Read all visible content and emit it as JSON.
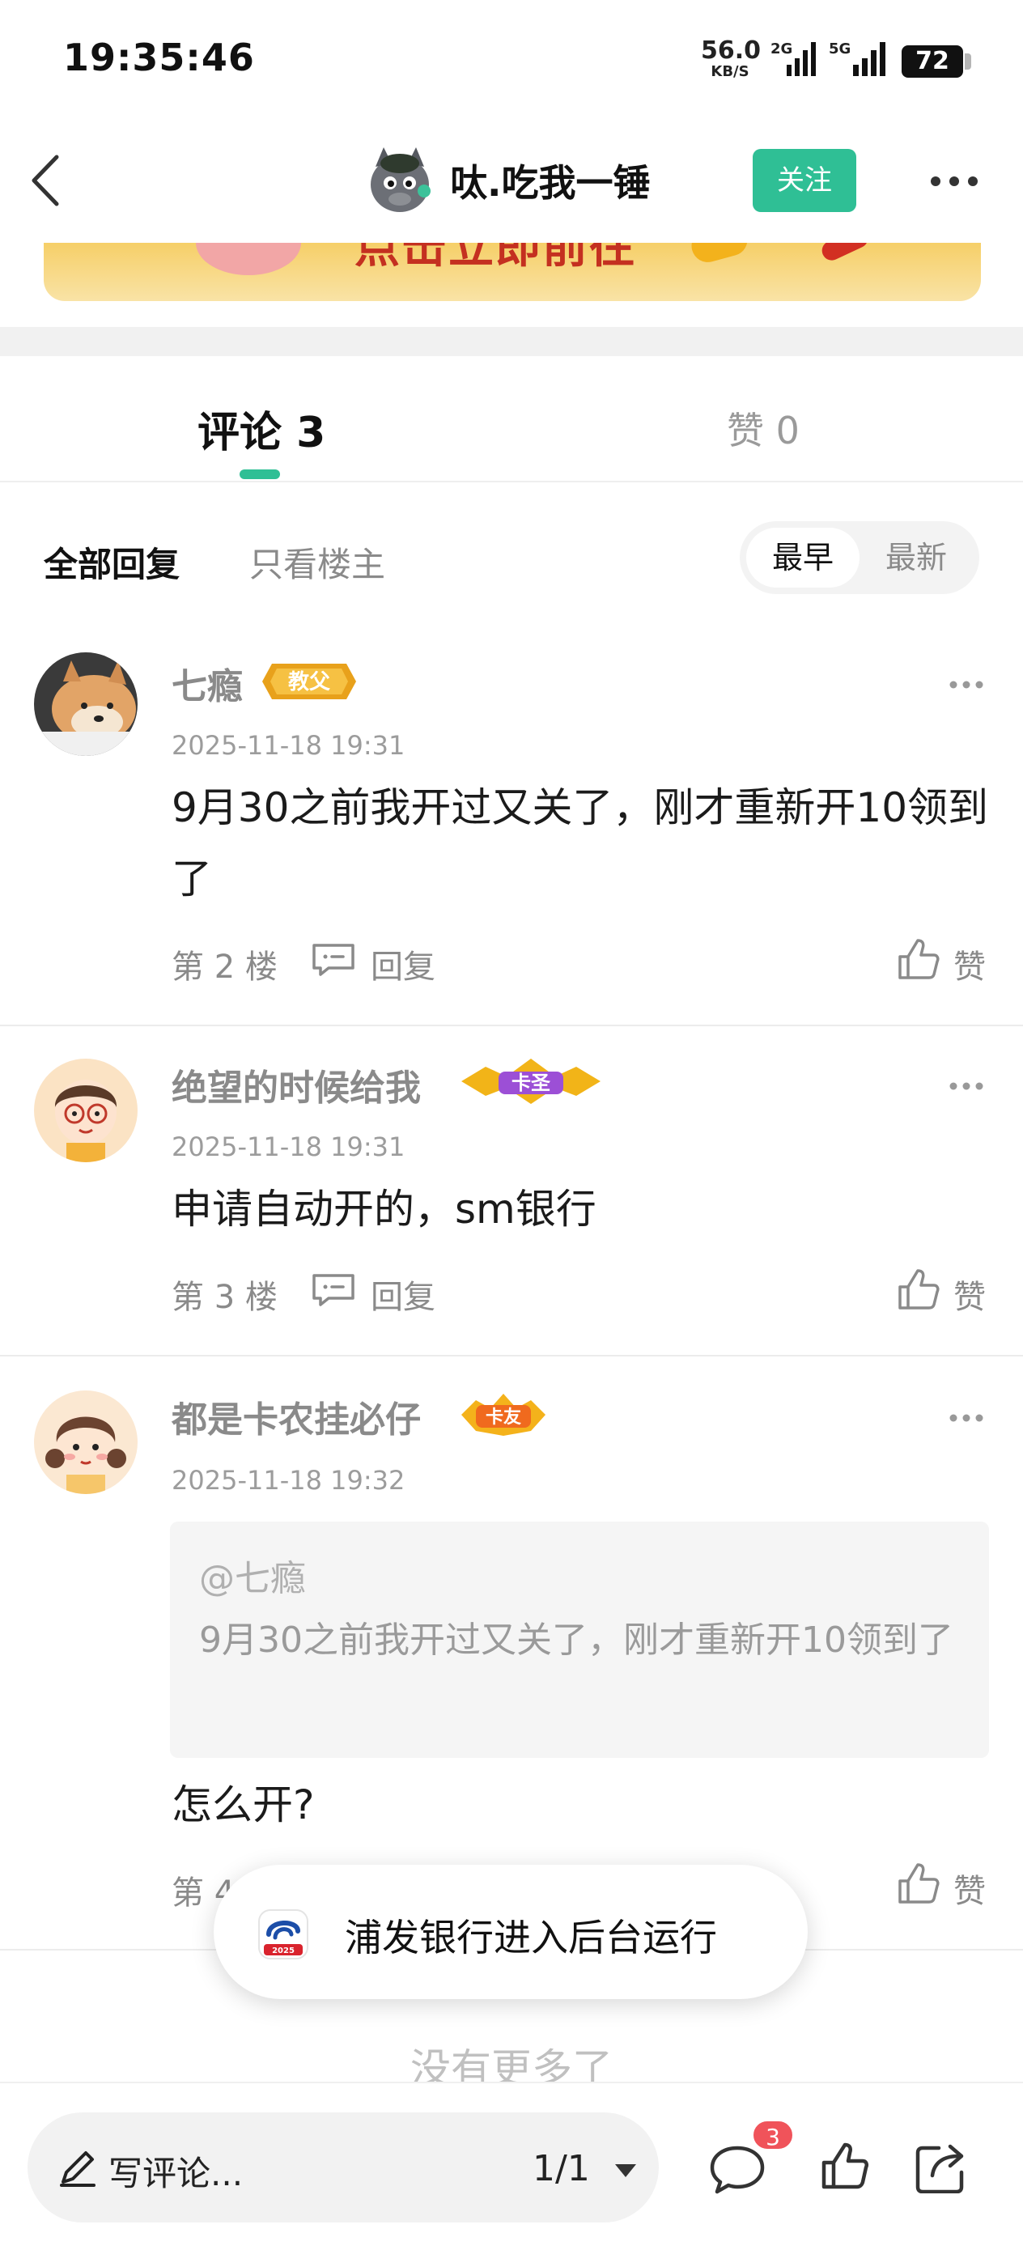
{
  "status_bar": {
    "time": "19:35:46",
    "net_speed_value": "56.0",
    "net_speed_unit": "KB/S",
    "sig1_label": "2G",
    "sig2_label": "5G",
    "battery": "72"
  },
  "nav": {
    "title": "呔.吃我一锤",
    "follow_label": "关注"
  },
  "banner": {
    "text": "点击立即前往"
  },
  "tabs": {
    "comments_label": "评论 3",
    "likes_label": "赞 0"
  },
  "filter": {
    "all_label": "全部回复",
    "op_only_label": "只看楼主",
    "sort_early": "最早",
    "sort_new": "最新"
  },
  "comments": [
    {
      "name": "七瘾",
      "badge": "教父",
      "time": "2025-11-18 19:31",
      "text": "9月30之前我开过又关了，刚才重新开10领到了",
      "floor": "第 2 楼",
      "reply_label": "回复",
      "like_label": "赞"
    },
    {
      "name": "绝望的时候给我",
      "badge": "卡圣",
      "time": "2025-11-18 19:31",
      "text": "申请自动开的，sm银行",
      "floor": "第 3 楼",
      "reply_label": "回复",
      "like_label": "赞"
    },
    {
      "name": "都是卡农挂必仔",
      "badge": "卡友",
      "time": "2025-11-18 19:32",
      "quote_at": "@七瘾",
      "quote_text": "9月30之前我开过又关了，刚才重新开10领到了",
      "text": "怎么开?",
      "floor": "第 4",
      "like_label": "赞"
    }
  ],
  "toast": {
    "text": "浦发银行进入后台运行",
    "icon_caption": "2025"
  },
  "footer": {
    "no_more": "没有更多了",
    "input_placeholder": "写评论...",
    "page": "1/1",
    "comment_count": "3"
  },
  "colors": {
    "accent": "#2fbf95",
    "badge_red": "#f0535a"
  }
}
